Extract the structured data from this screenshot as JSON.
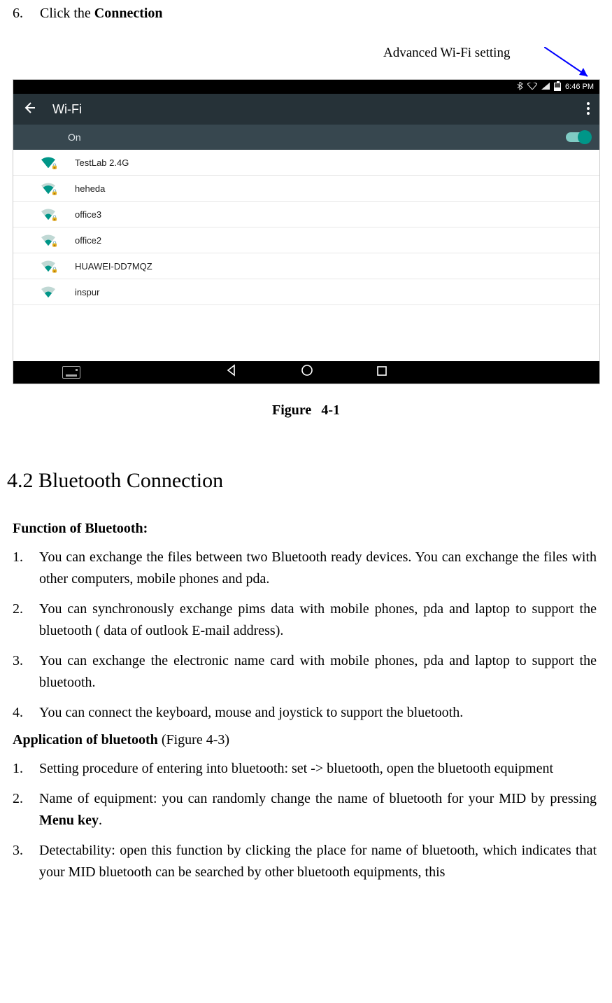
{
  "step": {
    "number": "6.",
    "prefix": "Click the ",
    "bold": "Connection"
  },
  "annotation": "Advanced Wi-Fi setting",
  "statusbar": {
    "time": "6:46 PM"
  },
  "appbar": {
    "title": "Wi-Fi"
  },
  "togglerow": {
    "label": "On"
  },
  "networks": [
    {
      "name": "TestLab 2.4G",
      "locked": true,
      "strength": 4
    },
    {
      "name": "heheda",
      "locked": true,
      "strength": 3
    },
    {
      "name": "office3",
      "locked": true,
      "strength": 2
    },
    {
      "name": "office2",
      "locked": true,
      "strength": 2
    },
    {
      "name": "HUAWEI-DD7MQZ",
      "locked": true,
      "strength": 2
    },
    {
      "name": "inspur",
      "locked": false,
      "strength": 2
    }
  ],
  "figure": {
    "label": "Figure",
    "num": "4-1"
  },
  "section_heading": "4.2 Bluetooth Connection",
  "func_head": "Function of Bluetooth:",
  "func_items": [
    "You can exchange the files between two Bluetooth ready devices. You can exchange the files with other computers, mobile phones and pda.",
    "You can synchronously exchange pims data with mobile phones, pda and laptop to support the bluetooth ( data of outlook E-mail address).",
    "You can exchange the electronic name card with mobile phones, pda and laptop to support the bluetooth.",
    "You can connect the keyboard, mouse and joystick to support the bluetooth."
  ],
  "app_head": {
    "bold": "Application of bluetooth",
    "rest": " (Figure 4-3)"
  },
  "app_items": [
    {
      "text": "Setting procedure of entering into bluetooth: set -> bluetooth, open the bluetooth equipment"
    },
    {
      "pre": "Name of equipment: you can randomly change the name of bluetooth for your MID by pressing ",
      "bold": "Menu key",
      "post": "."
    },
    {
      "text": "Detectability: open this function by clicking the place for name of bluetooth, which indicates that your MID bluetooth can be searched by other bluetooth equipments, this"
    }
  ]
}
